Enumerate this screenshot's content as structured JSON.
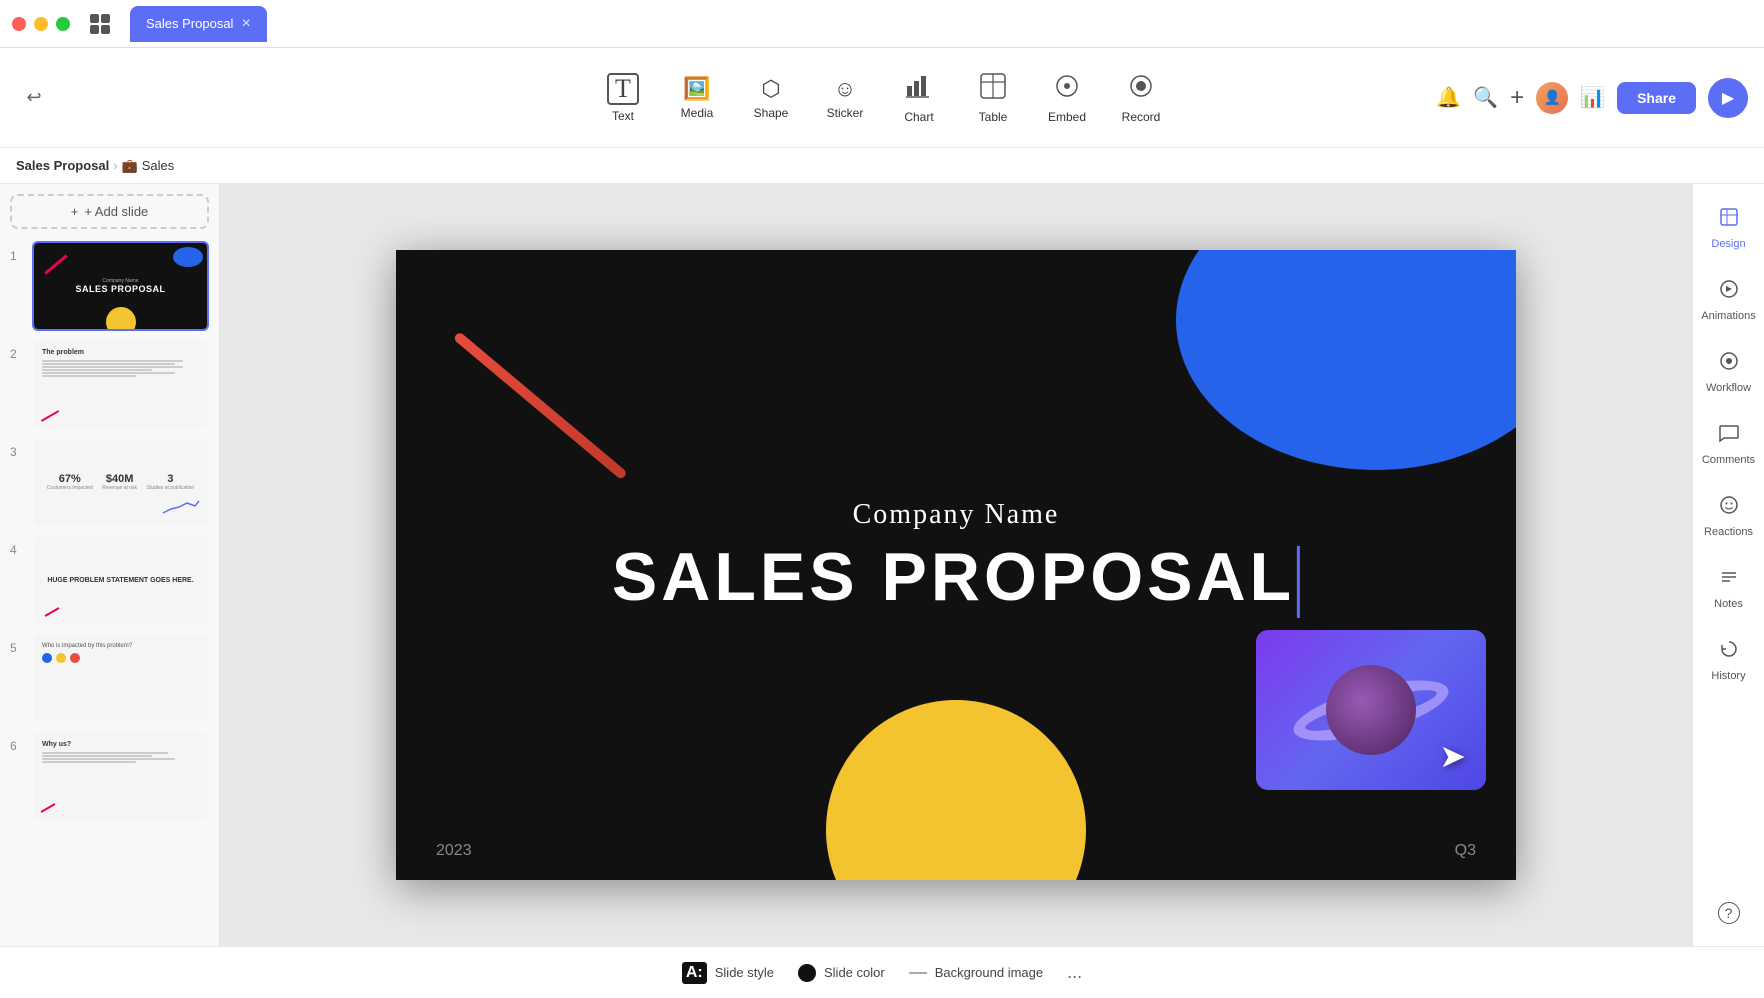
{
  "app": {
    "title": "Sales Proposal",
    "tab_label": "Sales Proposal"
  },
  "toolbar": {
    "undo_label": "↩",
    "tools": [
      {
        "id": "text",
        "label": "Text",
        "icon": "T"
      },
      {
        "id": "media",
        "label": "Media",
        "icon": "▦"
      },
      {
        "id": "shape",
        "label": "Shape",
        "icon": "⬡"
      },
      {
        "id": "sticker",
        "label": "Sticker",
        "icon": "☺"
      },
      {
        "id": "chart",
        "label": "Chart",
        "icon": "📊"
      },
      {
        "id": "table",
        "label": "Table",
        "icon": "⊞"
      },
      {
        "id": "embed",
        "label": "Embed",
        "icon": "⊙"
      },
      {
        "id": "record",
        "label": "Record",
        "icon": "⊚"
      }
    ],
    "share_label": "Share",
    "play_label": "▶"
  },
  "breadcrumb": {
    "title": "Sales Proposal",
    "emoji": "💼",
    "subtitle": "Sales"
  },
  "sidebar": {
    "add_slide_label": "+ Add slide",
    "slides": [
      {
        "number": "1",
        "label": "Slide 1 - Sales Proposal"
      },
      {
        "number": "2",
        "label": "Slide 2 - The Problem"
      },
      {
        "number": "3",
        "label": "Slide 3 - Stats"
      },
      {
        "number": "4",
        "label": "Slide 4 - Problem Statement"
      },
      {
        "number": "5",
        "label": "Slide 5 - Who is affected"
      },
      {
        "number": "6",
        "label": "Slide 6 - Why us"
      }
    ]
  },
  "canvas": {
    "company_name": "Company Name",
    "main_title": "SALES PROPOSAL",
    "year": "2023",
    "quarter": "Q3"
  },
  "slide3": {
    "stat1_val": "67%",
    "stat1_label": "Customers impacted",
    "stat2_val": "$40M",
    "stat2_label": "Revenue at risk",
    "stat3_val": "3",
    "stat3_label": "Studies at publication"
  },
  "slide4": {
    "title": "HUGE PROBLEM STATEMENT GOES HERE."
  },
  "slide5": {
    "title": "Who is impacted by this problem?"
  },
  "slide6": {
    "title": "Why us?"
  },
  "right_panel": {
    "tools": [
      {
        "id": "design",
        "label": "Design",
        "icon": "✦"
      },
      {
        "id": "animations",
        "label": "Animations",
        "icon": "◈"
      },
      {
        "id": "workflow",
        "label": "Workflow",
        "icon": "⊛"
      },
      {
        "id": "comments",
        "label": "Comments",
        "icon": "💬"
      },
      {
        "id": "reactions",
        "label": "Reactions",
        "icon": "☺"
      },
      {
        "id": "notes",
        "label": "Notes",
        "icon": "≡"
      },
      {
        "id": "history",
        "label": "History",
        "icon": "↺"
      }
    ],
    "help_label": "?"
  },
  "bottom_toolbar": {
    "slide_style_label": "Slide style",
    "slide_color_label": "Slide color",
    "background_image_label": "Background image",
    "more_label": "..."
  }
}
